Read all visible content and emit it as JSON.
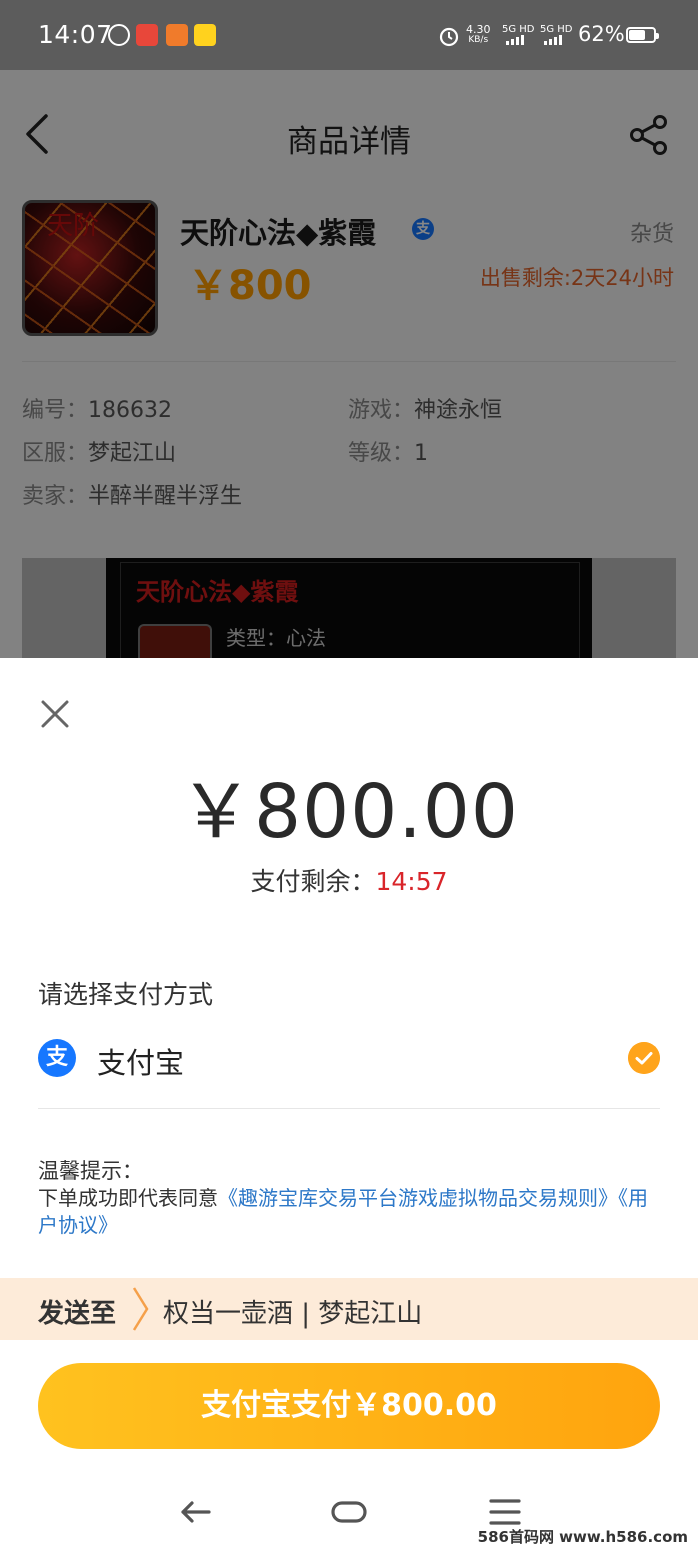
{
  "status_bar": {
    "time": "14:07",
    "net_speed": "4.30",
    "net_unit": "KB/s",
    "sig1": "5G HD",
    "sig2": "5G HD",
    "battery": "62%",
    "icons": [
      "loop-icon",
      "app-badge-icon",
      "app-badge-icon",
      "meituan-icon",
      "alarm-icon"
    ]
  },
  "header": {
    "title": "商品详情",
    "back_icon": "back-arrow-icon",
    "share_icon": "share-icon"
  },
  "product": {
    "thumb_text": "天阶",
    "name": "天阶心法◆紫霞",
    "pay_badge": "支",
    "price": "￥800",
    "category": "杂货",
    "remaining": "出售剩余:2天24小时"
  },
  "info": [
    {
      "key": "编号：",
      "value": "186632"
    },
    {
      "key": "游戏：",
      "value": "神途永恒"
    },
    {
      "key": "区服：",
      "value": "梦起江山"
    },
    {
      "key": "等级：",
      "value": "1"
    },
    {
      "key": "卖家：",
      "value": "半醉半醒半浮生"
    }
  ],
  "preview": {
    "title": "天阶心法◆紫霞",
    "type_line": "类型：心法"
  },
  "sheet": {
    "amount": "￥800.00",
    "timer_label": "支付剩余：",
    "timer_value": "14:57",
    "choose_label": "请选择支付方式",
    "method_icon": "支",
    "method_label": "支付宝",
    "tip_title": "温馨提示：",
    "tip_prefix": "下单成功即代表同意",
    "tip_link1": "《趣游宝库交易平台游戏虚拟物品交易规则》",
    "tip_link2": "《用户协议》",
    "send_label": "发送至",
    "send_value": "权当一壶酒 | 梦起江山",
    "pay_button": "支付宝支付￥800.00"
  },
  "watermark": "586首码网 www.h586.com",
  "colors": {
    "accent": "#ffa41b",
    "price": "#ff9d00",
    "timer": "#d9252a",
    "link": "#2d78c8",
    "alipay": "#1677ff"
  }
}
